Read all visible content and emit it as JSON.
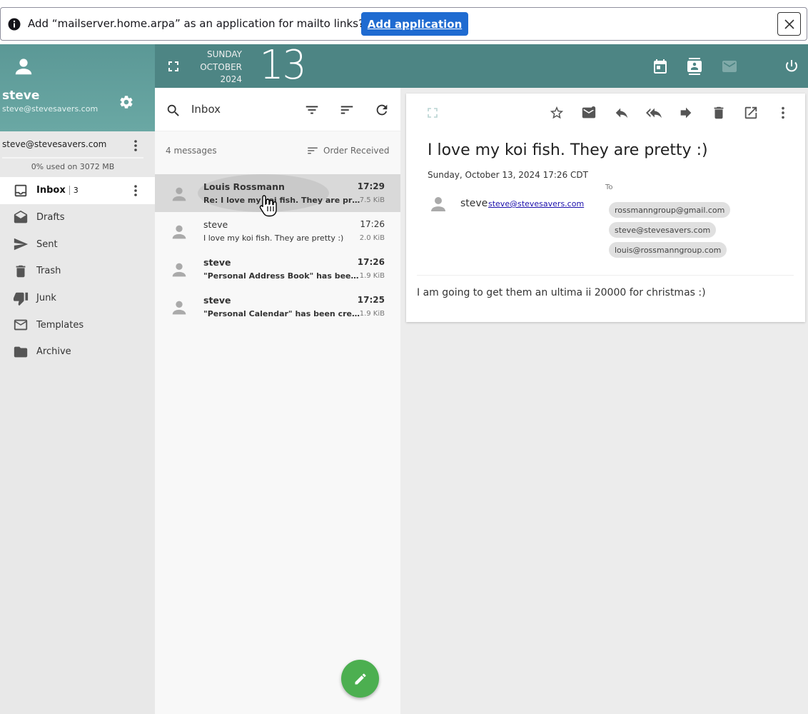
{
  "notification": {
    "message": "Add “mailserver.home.arpa” as an application for mailto links?",
    "add_button_label": "Add application"
  },
  "header": {
    "weekday": "SUNDAY",
    "month": "OCTOBER",
    "year": "2024",
    "day": "13"
  },
  "sidebar": {
    "user_name": "steve",
    "user_email": "steve@stevesavers.com",
    "account_address": "steve@stevesavers.com",
    "quota": "0% used on 3072 MB",
    "folders": [
      {
        "label": "Inbox",
        "count": "3",
        "icon": "inbox-icon"
      },
      {
        "label": "Drafts",
        "icon": "drafts-icon"
      },
      {
        "label": "Sent",
        "icon": "sent-icon"
      },
      {
        "label": "Trash",
        "icon": "trash-icon"
      },
      {
        "label": "Junk",
        "icon": "junk-icon"
      },
      {
        "label": "Templates",
        "icon": "templates-icon"
      },
      {
        "label": "Archive",
        "icon": "archive-icon"
      }
    ]
  },
  "message_list": {
    "folder": "Inbox",
    "count_label": "4 messages",
    "order_label": "Order Received",
    "messages": [
      {
        "from": "Louis Rossmann",
        "time": "17:29",
        "subject": "Re: I love my koi fish. They are pretty :)",
        "size": "7.5 KiB",
        "unread": true,
        "selected": true
      },
      {
        "from": "steve",
        "time": "17:26",
        "subject": "I love my koi fish. They are pretty :)",
        "size": "2.0 KiB",
        "unread": false,
        "selected": false
      },
      {
        "from": "steve",
        "time": "17:26",
        "subject": "\"Personal Address Book\" has been created",
        "size": "1.9 KiB",
        "unread": true,
        "selected": false
      },
      {
        "from": "steve",
        "time": "17:25",
        "subject": "\"Personal Calendar\" has been created",
        "size": "1.9 KiB",
        "unread": true,
        "selected": false
      }
    ]
  },
  "reader": {
    "subject": "I love my koi fish. They are pretty :)",
    "date": "Sunday, October 13, 2024 17:26 CDT",
    "sender_name": "steve",
    "sender_email": "steve@stevesavers.com",
    "to_label": "To",
    "recipients": [
      "rossmanngroup@gmail.com",
      "steve@stevesavers.com",
      "louis@rossmanngroup.com"
    ],
    "body": "I am going to get them an ultima ii 20000 for christmas :)"
  },
  "colors": {
    "header": "#4d8584",
    "profile": "#5b9896",
    "accent_button": "#1f6bd1",
    "compose": "#4caf50"
  }
}
